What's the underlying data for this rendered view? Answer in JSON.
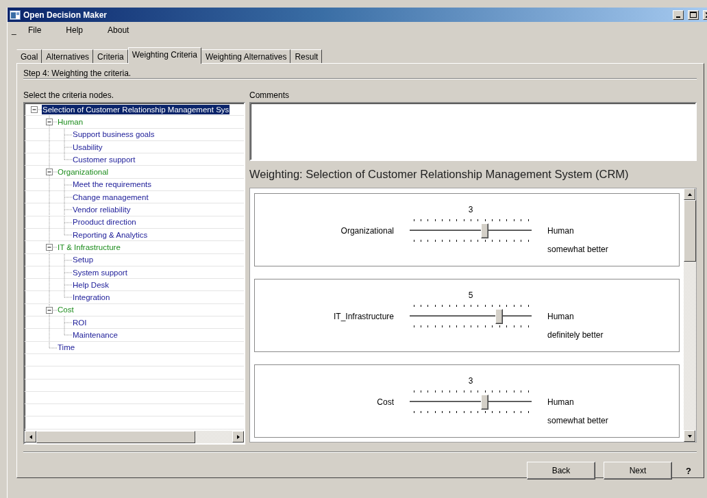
{
  "window": {
    "title": "Open Decision Maker"
  },
  "menu": {
    "mark": "_",
    "items": [
      "File",
      "Help",
      "About"
    ]
  },
  "tabs": [
    {
      "label": "Goal",
      "selected": false
    },
    {
      "label": "Alternatives",
      "selected": false
    },
    {
      "label": "Criteria",
      "selected": false
    },
    {
      "label": "Weighting Criteria",
      "selected": true
    },
    {
      "label": "Weighting Alternatives",
      "selected": false
    },
    {
      "label": "Result",
      "selected": false
    }
  ],
  "step": "Step 4: Weighting the criteria.",
  "tree_panel": {
    "label": "Select the criteria nodes.",
    "nodes": [
      {
        "label": "Selection of Customer Relationship Management Sys",
        "selected": true,
        "expanded": true,
        "children": [
          {
            "label": "Human",
            "selected": false,
            "expanded": true,
            "children": [
              {
                "label": "Support business goals",
                "selected": false
              },
              {
                "label": "Usability",
                "selected": false
              },
              {
                "label": "Customer support",
                "selected": false
              }
            ]
          },
          {
            "label": "Organizational",
            "selected": false,
            "expanded": true,
            "children": [
              {
                "label": "Meet the requirements",
                "selected": false
              },
              {
                "label": "Change management",
                "selected": false
              },
              {
                "label": "Vendor reliability",
                "selected": false
              },
              {
                "label": "Prooduct direction",
                "selected": false
              },
              {
                "label": "Reporting & Analytics",
                "selected": false
              }
            ]
          },
          {
            "label": "IT & Infrastructure",
            "selected": false,
            "expanded": true,
            "children": [
              {
                "label": "Setup",
                "selected": false
              },
              {
                "label": "System support",
                "selected": false
              },
              {
                "label": "Help Desk",
                "selected": false
              },
              {
                "label": "Integration",
                "selected": false
              }
            ]
          },
          {
            "label": "Cost",
            "selected": false,
            "expanded": true,
            "children": [
              {
                "label": "ROI",
                "selected": false
              },
              {
                "label": "Maintenance",
                "selected": false
              }
            ]
          },
          {
            "label": "Time",
            "selected": false
          }
        ]
      }
    ]
  },
  "comments": {
    "label": "Comments"
  },
  "weighting": {
    "heading": "Weighting: Selection of Customer Relationship Management System (CRM)",
    "comparisons": [
      {
        "value": "3",
        "left": "Organizational",
        "right": "Human",
        "level": 0.625,
        "verdict": "somewhat better"
      },
      {
        "value": "5",
        "left": "IT_Infrastructure",
        "right": "Human",
        "level": 0.75,
        "verdict": "definitely better"
      },
      {
        "value": "3",
        "left": "Cost",
        "right": "Human",
        "level": 0.625,
        "verdict": "somewhat better"
      }
    ]
  },
  "buttons": [
    "Back",
    "Next"
  ],
  "help": "?"
}
